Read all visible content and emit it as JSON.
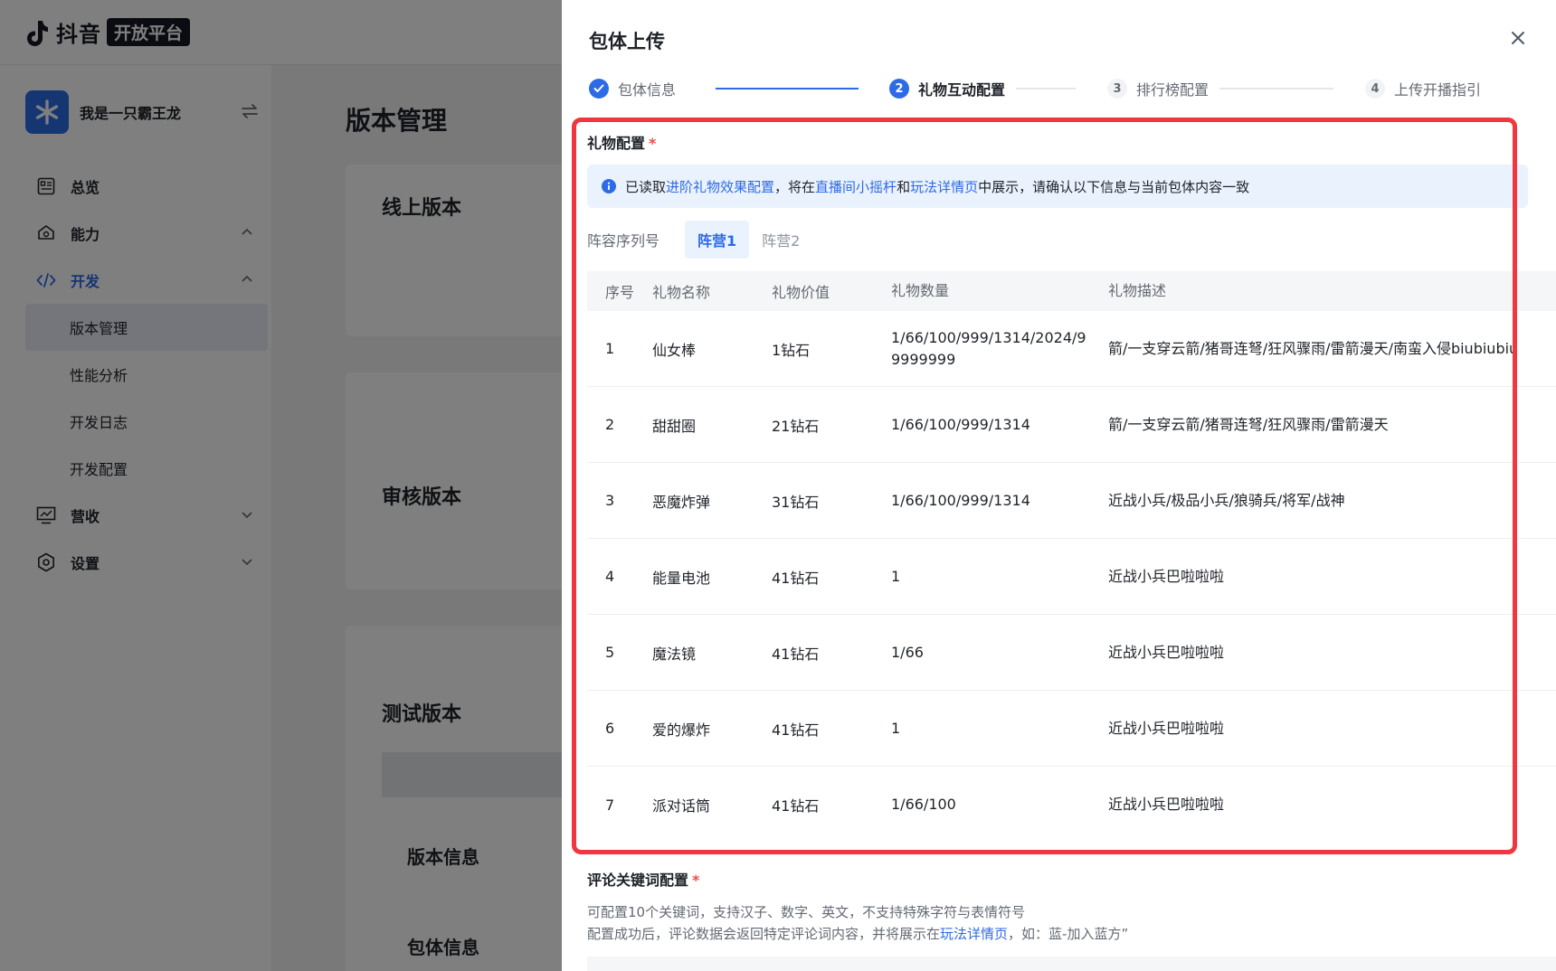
{
  "logo": {
    "text": "抖音",
    "badge": "开放平台"
  },
  "account": {
    "name": "我是一只霸王龙"
  },
  "nav": {
    "overview": "总览",
    "ability": "能力",
    "develop": "开发",
    "sub": [
      "版本管理",
      "性能分析",
      "开发日志",
      "开发配置"
    ],
    "revenue": "营收",
    "settings": "设置"
  },
  "main": {
    "page_title": "版本管理",
    "online": "线上版本",
    "review": "审核版本",
    "test": "测试版本",
    "version_info": "版本信息",
    "package_info": "包体信息"
  },
  "drawer": {
    "title": "包体上传",
    "steps": [
      {
        "num": "1",
        "label": "包体信息",
        "status": "done"
      },
      {
        "num": "2",
        "label": "礼物互动配置",
        "status": "current"
      },
      {
        "num": "3",
        "label": "排行榜配置",
        "status": "todo"
      },
      {
        "num": "4",
        "label": "上传开播指引",
        "status": "todo"
      }
    ],
    "gift_section": {
      "title": "礼物配置",
      "required": "*",
      "notice": {
        "t1": "已读取",
        "l1": "进阶礼物效果配置",
        "t2": "，将在",
        "l2": "直播间小摇杆",
        "t3": "和",
        "l3": "玩法详情页",
        "t4": "中展示，请确认以下信息与当前包体内容一致"
      },
      "tabs_label": "阵容序列号",
      "tabs": [
        "阵营1",
        "阵营2"
      ],
      "columns": [
        "序号",
        "礼物名称",
        "礼物价值",
        "礼物数量",
        "礼物描述"
      ],
      "rows": [
        {
          "no": "1",
          "name": "仙女棒",
          "value": "1钻石",
          "qty": "1/66/100/999/1314/2024/99999999",
          "desc": "箭/一支穿云箭/猪哥连弩/狂风骤雨/雷箭漫天/南蛮入侵biubiubiu"
        },
        {
          "no": "2",
          "name": "甜甜圈",
          "value": "21钻石",
          "qty": "1/66/100/999/1314",
          "desc": "箭/一支穿云箭/猪哥连弩/狂风骤雨/雷箭漫天"
        },
        {
          "no": "3",
          "name": "恶魔炸弹",
          "value": "31钻石",
          "qty": "1/66/100/999/1314",
          "desc": "近战小兵/极品小兵/狼骑兵/将军/战神"
        },
        {
          "no": "4",
          "name": "能量电池",
          "value": "41钻石",
          "qty": "1",
          "desc": "近战小兵巴啦啦啦"
        },
        {
          "no": "5",
          "name": "魔法镜",
          "value": "41钻石",
          "qty": "1/66",
          "desc": "近战小兵巴啦啦啦"
        },
        {
          "no": "6",
          "name": "爱的爆炸",
          "value": "41钻石",
          "qty": "1",
          "desc": "近战小兵巴啦啦啦"
        },
        {
          "no": "7",
          "name": "派对话筒",
          "value": "41钻石",
          "qty": "1/66/100",
          "desc": "近战小兵巴啦啦啦"
        }
      ]
    },
    "comment_section": {
      "title": "评论关键词配置",
      "required": "*",
      "line1": "可配置10个关键词，支持汉子、数字、英文，不支持特殊字符与表情符号",
      "line2a": "配置成功后，评论数据会返回特定评论词内容，并将展示在",
      "line2_link": "玩法详情页",
      "line2b": "，如：蓝-加入蓝方”"
    }
  },
  "colors": {
    "accent": "#2d6be6",
    "highlight": "#f0373f",
    "required": "#f54a45"
  }
}
